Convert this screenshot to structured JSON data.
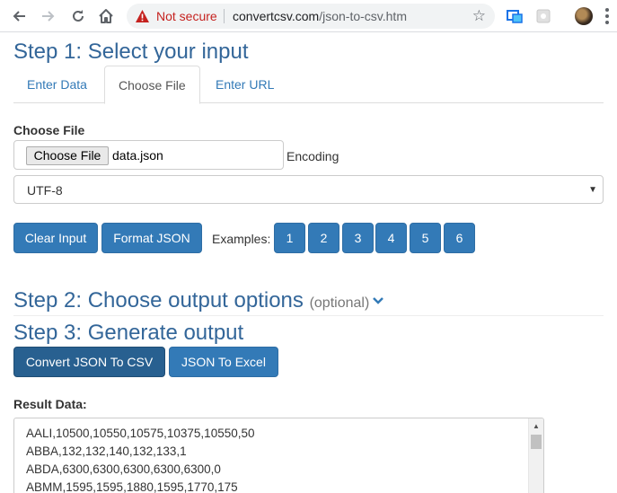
{
  "browser": {
    "security_label": "Not secure",
    "url_host": "convertcsv.com",
    "url_path": "/json-to-csv.htm"
  },
  "step1": {
    "title": "Step 1: Select your input",
    "tabs": [
      {
        "label": "Enter Data",
        "active": false
      },
      {
        "label": "Choose File",
        "active": true
      },
      {
        "label": "Enter URL",
        "active": false
      }
    ],
    "choose_file_label": "Choose File",
    "file_button": "Choose File",
    "file_name": "data.json",
    "encoding_label": "Encoding",
    "encoding_value": "UTF-8",
    "clear_button": "Clear Input",
    "format_button": "Format JSON",
    "examples_label": "Examples:",
    "examples": [
      "1",
      "2",
      "3",
      "4",
      "5",
      "6"
    ]
  },
  "step2": {
    "title": "Step 2: Choose output options",
    "optional": "(optional)"
  },
  "step3": {
    "title": "Step 3: Generate output",
    "convert_button": "Convert JSON To CSV",
    "excel_button": "JSON To Excel",
    "result_label": "Result Data:",
    "result_lines": [
      "AALI,10500,10550,10575,10375,10550,50",
      "ABBA,132,132,140,132,133,1",
      "ABDA,6300,6300,6300,6300,6300,0",
      "ABMM,1595,1595,1880,1595,1770,175"
    ]
  },
  "colors": {
    "primary": "#337ab7",
    "primary_active": "#286090",
    "heading": "#336699",
    "warning": "#c5221f"
  }
}
